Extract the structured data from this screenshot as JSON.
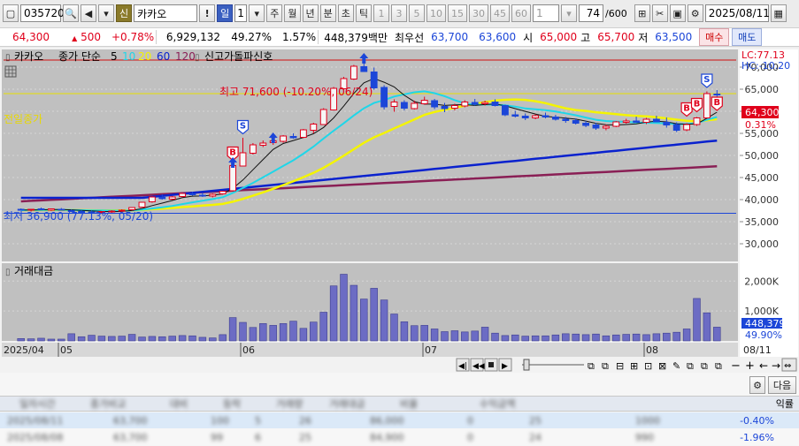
{
  "toolbar": {
    "code": "035720",
    "badge": "신",
    "name": "카카오",
    "periods": [
      "일",
      "1",
      "주",
      "월",
      "년",
      "분",
      "초",
      "틱"
    ],
    "active_period": "일",
    "numbers": [
      "1",
      "3",
      "5",
      "10",
      "15",
      "30",
      "45",
      "60"
    ],
    "num_sel": "1",
    "count": "74",
    "count_total": "/600",
    "date": "2025/08/11"
  },
  "quote": {
    "price": "64,300",
    "change": "500",
    "change_pct": "+0.78%",
    "volume": "6,929,132",
    "volume_ratio": "49.27%",
    "turnover": "1.57%",
    "trade_value": "448,379백만",
    "priority_label": "최우선",
    "ask": "63,700",
    "bid": "63,600",
    "open_label": "시",
    "open": "65,000",
    "high_label": "고",
    "high": "65,700",
    "low_label": "저",
    "low": "63,500",
    "buy": "매수",
    "sell": "매도"
  },
  "legend": {
    "name": "카카오",
    "type": "종가 단순",
    "ma": [
      "5",
      "10",
      "20",
      "60",
      "120"
    ],
    "signal": "신고가돌파신호"
  },
  "chart_labels": {
    "lc": "LC:77.13",
    "hc": "HC:-10.20",
    "prev_close": "전일종가",
    "high_note": "최고 71,600 (-10.20%, 06/24)",
    "low_note": "최저 36,900 (77.13%, 05/20)",
    "price_tag": "64,300",
    "pct_tag": "0.31%",
    "volume_title": "거래대금",
    "vol_tag": "448,379",
    "vol_pct_tag": "49.90%"
  },
  "chart_data": {
    "type": "candlestick",
    "price_ticks": [
      "70,000",
      "65,000",
      "60,000",
      "55,000",
      "50,000",
      "45,000",
      "40,000",
      "35,000",
      "30,000"
    ],
    "volume_ticks": [
      "2,000K",
      "1,000K"
    ],
    "x_labels": [
      "2025/04",
      "05",
      "06",
      "07",
      "08",
      "08/11"
    ],
    "ylim": [
      26000,
      74000
    ],
    "high_line": 71600,
    "low_line": 36900,
    "prev_close": 64000,
    "candles": [
      [
        37800,
        38000,
        37500,
        37700
      ],
      [
        37600,
        37900,
        37300,
        37800
      ],
      [
        37900,
        38200,
        37600,
        37700
      ],
      [
        37600,
        38000,
        37400,
        37900
      ],
      [
        37800,
        38100,
        37500,
        37600
      ],
      [
        37500,
        37800,
        37200,
        37400
      ],
      [
        37300,
        37600,
        37000,
        37200
      ],
      [
        37200,
        37500,
        36900,
        37100
      ],
      [
        37100,
        37400,
        36900,
        37300
      ],
      [
        37300,
        37600,
        37000,
        37400
      ],
      [
        37500,
        37800,
        37200,
        37600
      ],
      [
        37700,
        38300,
        37500,
        38200
      ],
      [
        38300,
        39500,
        38200,
        39400
      ],
      [
        39500,
        40800,
        39300,
        40600
      ],
      [
        40500,
        41200,
        40000,
        40200
      ],
      [
        40100,
        40800,
        39900,
        40600
      ],
      [
        40700,
        41600,
        40500,
        41400
      ],
      [
        41300,
        41800,
        40900,
        41100
      ],
      [
        41000,
        41500,
        40600,
        40800
      ],
      [
        40800,
        41400,
        40500,
        41200
      ],
      [
        41300,
        42000,
        41100,
        41900
      ],
      [
        42000,
        48000,
        41900,
        47700
      ],
      [
        47600,
        54000,
        47500,
        50600
      ],
      [
        50500,
        52800,
        50200,
        52400
      ],
      [
        52300,
        53400,
        51900,
        52800
      ],
      [
        52900,
        53600,
        52400,
        53300
      ],
      [
        53200,
        54600,
        52900,
        54400
      ],
      [
        54300,
        55000,
        53800,
        54000
      ],
      [
        54100,
        56000,
        53900,
        55800
      ],
      [
        55700,
        57400,
        55000,
        57100
      ],
      [
        57000,
        60700,
        56900,
        60400
      ],
      [
        60300,
        65500,
        60200,
        65200
      ],
      [
        65100,
        67800,
        64900,
        67400
      ],
      [
        67300,
        70500,
        67100,
        70200
      ],
      [
        70100,
        71600,
        68900,
        69000
      ],
      [
        68900,
        69900,
        64900,
        65300
      ],
      [
        65400,
        65900,
        60400,
        61000
      ],
      [
        61100,
        62700,
        59900,
        62100
      ],
      [
        62000,
        62500,
        60200,
        60700
      ],
      [
        60600,
        62400,
        60400,
        61800
      ],
      [
        61700,
        63300,
        61500,
        62500
      ],
      [
        62400,
        62800,
        60500,
        61000
      ],
      [
        61100,
        61900,
        59800,
        60600
      ],
      [
        60700,
        61700,
        60200,
        61300
      ],
      [
        61200,
        62500,
        60900,
        62100
      ],
      [
        62000,
        62800,
        61300,
        61600
      ],
      [
        61700,
        62400,
        61300,
        62000
      ],
      [
        62100,
        62700,
        61100,
        61300
      ],
      [
        61300,
        61500,
        58900,
        59200
      ],
      [
        59200,
        60100,
        58600,
        58900
      ],
      [
        58900,
        59500,
        58000,
        58500
      ],
      [
        58500,
        59300,
        58200,
        59000
      ],
      [
        59000,
        59700,
        58400,
        58700
      ],
      [
        58700,
        59200,
        57900,
        58200
      ],
      [
        58200,
        58700,
        57400,
        57900
      ],
      [
        57900,
        58400,
        57000,
        57300
      ],
      [
        57300,
        57800,
        56400,
        56800
      ],
      [
        56900,
        57400,
        55800,
        56200
      ],
      [
        56200,
        57000,
        55700,
        56600
      ],
      [
        56600,
        57800,
        56400,
        57600
      ],
      [
        57500,
        58300,
        57200,
        57800
      ],
      [
        57800,
        58800,
        57400,
        57500
      ],
      [
        57500,
        58500,
        57100,
        58200
      ],
      [
        58200,
        59000,
        57500,
        57600
      ],
      [
        57500,
        58600,
        56300,
        56900
      ],
      [
        57000,
        57500,
        55300,
        55700
      ],
      [
        55800,
        57300,
        55500,
        57000
      ],
      [
        57000,
        58700,
        56700,
        58500
      ],
      [
        58500,
        64500,
        58300,
        64000
      ],
      [
        63900,
        64800,
        63000,
        63800
      ]
    ],
    "signals": [
      {
        "index": 21,
        "kind": "B",
        "price": 50500
      },
      {
        "index": 22,
        "kind": "S",
        "price": 56500
      },
      {
        "index": 66,
        "kind": "B",
        "price": 60500
      },
      {
        "index": 67,
        "kind": "B",
        "price": 61500
      },
      {
        "index": 68,
        "kind": "S",
        "price": 67000
      },
      {
        "index": 69,
        "kind": "B",
        "price": 61800
      }
    ],
    "arrows": [
      {
        "index": 21
      },
      {
        "index": 25
      },
      {
        "index": 34
      }
    ],
    "volume": [
      80,
      70,
      90,
      60,
      60,
      240,
      140,
      190,
      160,
      150,
      160,
      220,
      130,
      150,
      140,
      160,
      180,
      170,
      120,
      100,
      210,
      780,
      620,
      450,
      580,
      520,
      580,
      660,
      420,
      630,
      960,
      1840,
      2230,
      1860,
      1400,
      1760,
      1370,
      900,
      640,
      510,
      520,
      400,
      310,
      340,
      300,
      330,
      460,
      260,
      180,
      200,
      160,
      170,
      170,
      200,
      240,
      230,
      210,
      230,
      170,
      200,
      220,
      230,
      210,
      240,
      260,
      290,
      400,
      1420,
      940,
      460
    ]
  },
  "bottom": {
    "next": "다음",
    "rate_label": "익률",
    "rows": [
      {
        "blur": [
          "2025/08/11",
          "63,700",
          "100",
          "5",
          "26",
          "86,000",
          "0",
          "25",
          "1000"
        ],
        "rate": "-0.40%"
      },
      {
        "blur": [
          "2025/08/08",
          "63,700",
          "99",
          "6",
          "25",
          "84,900",
          "0",
          "24",
          "990"
        ],
        "rate": "-1.96%"
      }
    ]
  }
}
